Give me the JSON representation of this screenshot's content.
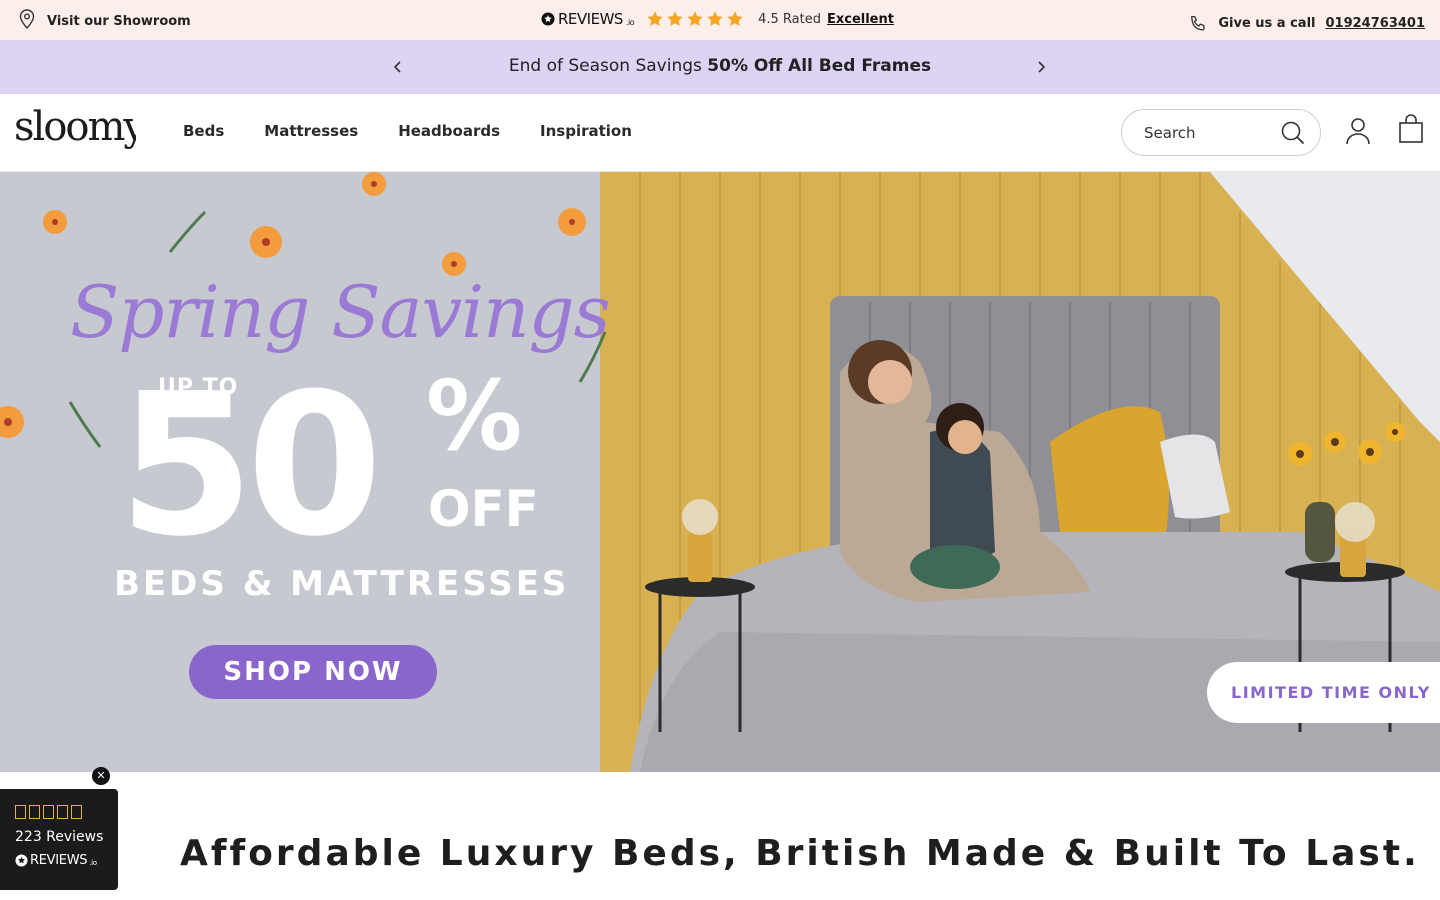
{
  "topbar": {
    "showroom_label": "Visit our Showroom",
    "reviews_brand": "REVIEWS",
    "reviews_brand_suffix": ".io",
    "rating_text": "4.5 Rated",
    "rating_word": "Excellent",
    "rating_stars": 5,
    "call_label": "Give us a call",
    "phone": "01924763401"
  },
  "promo": {
    "text_prefix": "End of Season Savings ",
    "text_bold": "50% Off All Bed Frames"
  },
  "header": {
    "logo_text": "sloomy",
    "nav": [
      {
        "label": "Beds"
      },
      {
        "label": "Mattresses"
      },
      {
        "label": "Headboards"
      },
      {
        "label": "Inspiration"
      }
    ],
    "search_placeholder": "Search"
  },
  "hero": {
    "script_title": "Spring Savings",
    "up_to": "UP TO",
    "big_number": "50",
    "percent": "%",
    "off": "OFF",
    "subtitle": "BEDS & MATTRESSES",
    "cta_label": "SHOP NOW",
    "badge": "LIMITED TIME ONLY"
  },
  "tagline": "Affordable Luxury Beds, British Made & Built To Last.",
  "reviews_widget": {
    "close_label": "✕",
    "stars": 5,
    "count": "223 Reviews",
    "brand": "REVIEWS",
    "brand_suffix": ".io"
  },
  "colors": {
    "topbar_bg": "#fcefe9",
    "promo_bg": "#ddd3f3",
    "accent_purple": "#8a66cc",
    "star_orange": "#f5a623",
    "widget_bg": "#1b1b1b"
  }
}
